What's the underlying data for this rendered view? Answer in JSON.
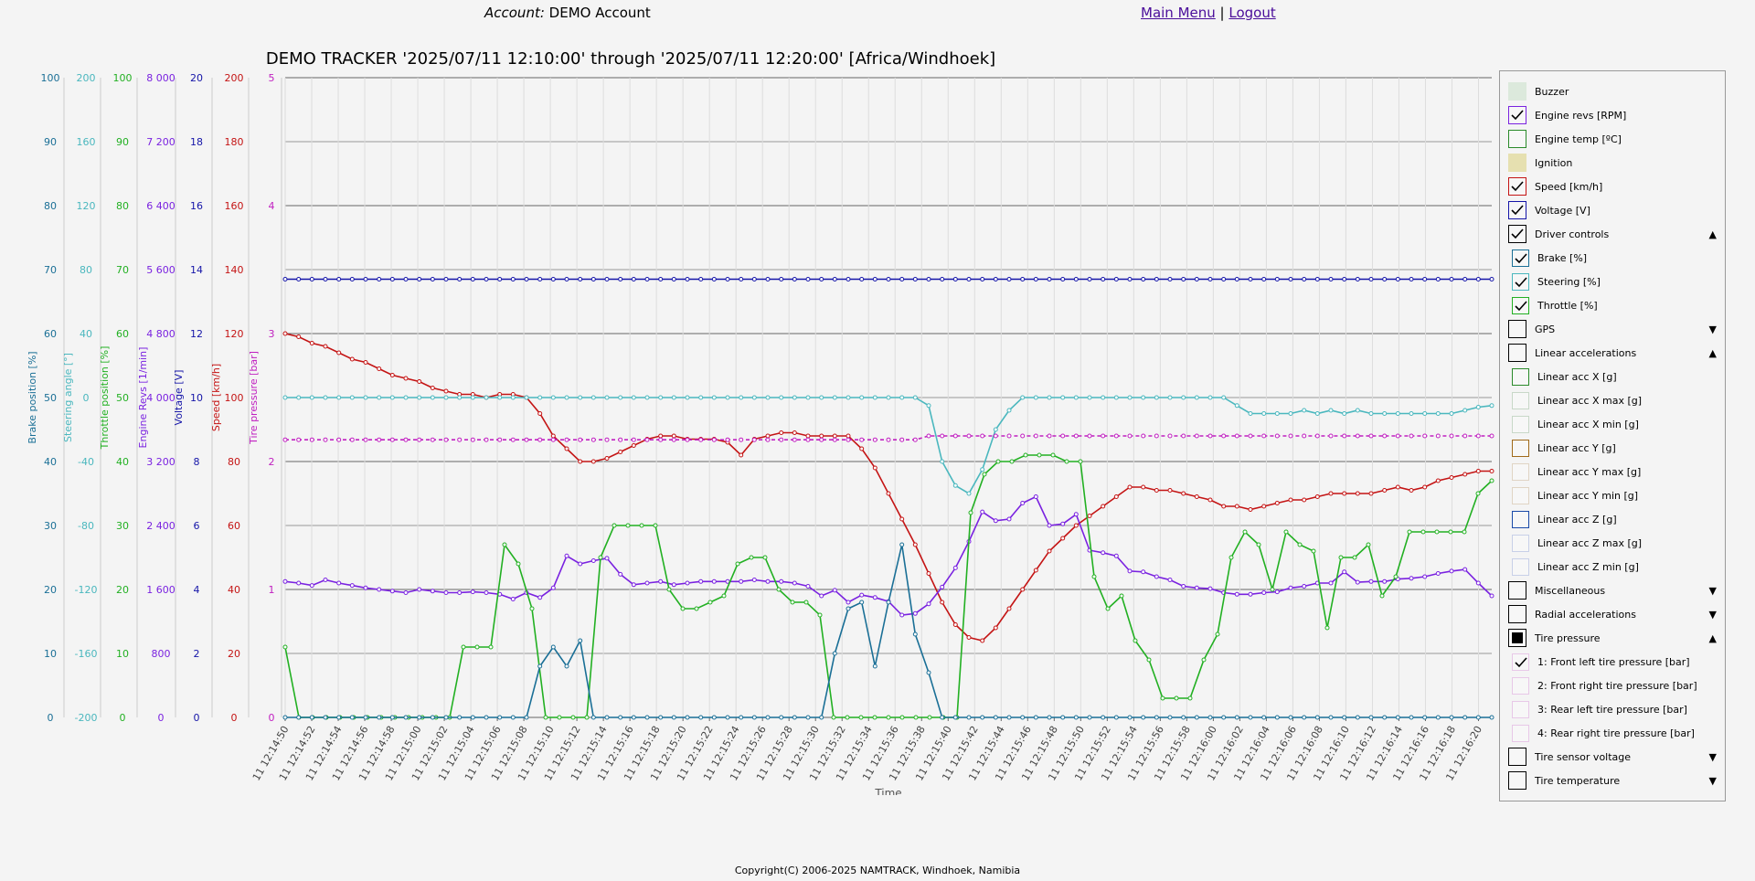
{
  "header": {
    "account_label": "Account:",
    "account_name": "DEMO Account",
    "main_menu": "Main Menu",
    "separator": "|",
    "logout": "Logout"
  },
  "footer": {
    "copyright": "Copyright(C) 2006-2025 NAMTRACK, Windhoek, Namibia"
  },
  "chart_data": {
    "type": "line",
    "title": "DEMO TRACKER '2025/07/11 12:10:00' through '2025/07/11 12:20:00' [Africa/Windhoek]",
    "xlabel": "Time",
    "x_range": [
      "11 12:14:50",
      "11 12:16:21"
    ],
    "x_ticks": [
      "11 12:14:50",
      "11 12:14:52",
      "11 12:14:54",
      "11 12:14:56",
      "11 12:14:58",
      "11 12:15:00",
      "11 12:15:02",
      "11 12:15:04",
      "11 12:15:06",
      "11 12:15:08",
      "11 12:15:10",
      "11 12:15:12",
      "11 12:15:14",
      "11 12:15:16",
      "11 12:15:18",
      "11 12:15:20",
      "11 12:15:22",
      "11 12:15:24",
      "11 12:15:26",
      "11 12:15:28",
      "11 12:15:30",
      "11 12:15:32",
      "11 12:15:34",
      "11 12:15:36",
      "11 12:15:38",
      "11 12:15:40",
      "11 12:15:42",
      "11 12:15:44",
      "11 12:15:46",
      "11 12:15:48",
      "11 12:15:50",
      "11 12:15:52",
      "11 12:15:54",
      "11 12:15:56",
      "11 12:15:58",
      "11 12:16:00",
      "11 12:16:02",
      "11 12:16:04",
      "11 12:16:06",
      "11 12:16:08",
      "11 12:16:10",
      "11 12:16:12",
      "11 12:16:14",
      "11 12:16:16",
      "11 12:16:18",
      "11 12:16:20"
    ],
    "grid": true,
    "axes": [
      {
        "label": "Brake position [%]",
        "color": "#1a6f96",
        "ticks": [
          "0",
          "10",
          "20",
          "30",
          "40",
          "50",
          "60",
          "70",
          "80",
          "90",
          "100"
        ],
        "range": [
          0,
          100
        ]
      },
      {
        "label": "Steering angle [°]",
        "color": "#4ab7be",
        "ticks": [
          "-200",
          "-160",
          "-120",
          "-80",
          "-40",
          "0",
          "40",
          "80",
          "120",
          "160",
          "200"
        ],
        "range": [
          -200,
          200
        ]
      },
      {
        "label": "Throttle position [%]",
        "color": "#22b022",
        "ticks": [
          "0",
          "10",
          "20",
          "30",
          "40",
          "50",
          "60",
          "70",
          "80",
          "90",
          "100"
        ],
        "range": [
          0,
          100
        ]
      },
      {
        "label": "Engine Revs [1/min]",
        "color": "#7a22e0",
        "ticks": [
          "0",
          "800",
          "1 600",
          "2 400",
          "3 200",
          "4 000",
          "4 800",
          "5 600",
          "6 400",
          "7 200",
          "8 000"
        ],
        "range": [
          0,
          8000
        ]
      },
      {
        "label": "Voltage [V]",
        "color": "#1515a8",
        "ticks": [
          "0",
          "2",
          "4",
          "6",
          "8",
          "10",
          "12",
          "14",
          "16",
          "18",
          "20"
        ],
        "range": [
          0,
          20
        ]
      },
      {
        "label": "Speed [km/h]",
        "color": "#c41414",
        "ticks": [
          "0",
          "20",
          "40",
          "60",
          "80",
          "100",
          "120",
          "140",
          "160",
          "180",
          "200"
        ],
        "range": [
          0,
          200
        ]
      },
      {
        "label": "Tire pressure [bar]",
        "color": "#c020c0",
        "ticks": [
          "0",
          "1",
          "2",
          "3",
          "4",
          "5"
        ],
        "range": [
          0,
          5
        ]
      }
    ],
    "series": [
      {
        "name": "Speed [km/h]",
        "axis": 5,
        "color": "#c41414",
        "values": [
          120,
          119,
          117,
          116,
          114,
          112,
          111,
          109,
          107,
          106,
          105,
          103,
          102,
          101,
          101,
          100,
          101,
          101,
          100,
          95,
          88,
          84,
          80,
          80,
          81,
          83,
          85,
          87,
          88,
          88,
          87,
          87,
          87,
          86,
          82,
          87,
          88,
          89,
          89,
          88,
          88,
          88,
          88,
          84,
          78,
          70,
          62,
          54,
          45,
          36,
          29,
          25,
          24,
          28,
          34,
          40,
          46,
          52,
          56,
          60,
          63,
          66,
          69,
          72,
          72,
          71,
          71,
          70,
          69,
          68,
          66,
          66,
          65,
          66,
          67,
          68,
          68,
          69,
          70,
          70,
          70,
          70,
          71,
          72,
          71,
          72,
          74,
          75,
          76,
          77,
          77
        ]
      },
      {
        "name": "Voltage [V]",
        "axis": 4,
        "color": "#1515a8",
        "values": [
          13.7,
          13.7,
          13.7,
          13.7,
          13.7,
          13.7,
          13.7,
          13.7,
          13.7,
          13.7,
          13.7,
          13.7,
          13.7,
          13.7,
          13.7,
          13.7,
          13.7,
          13.7,
          13.7,
          13.7,
          13.7,
          13.7,
          13.7,
          13.7,
          13.7,
          13.7,
          13.7,
          13.7,
          13.7,
          13.7,
          13.7,
          13.7,
          13.7,
          13.7,
          13.7,
          13.7,
          13.7,
          13.7,
          13.7,
          13.7,
          13.7,
          13.7,
          13.7,
          13.7,
          13.7,
          13.7,
          13.7,
          13.7,
          13.7,
          13.7,
          13.7,
          13.7,
          13.7,
          13.7,
          13.7,
          13.7,
          13.7,
          13.7,
          13.7,
          13.7,
          13.7,
          13.7,
          13.7,
          13.7,
          13.7,
          13.7,
          13.7,
          13.7,
          13.7,
          13.7,
          13.7,
          13.7,
          13.7,
          13.7,
          13.7,
          13.7,
          13.7,
          13.7,
          13.7,
          13.7,
          13.7,
          13.7,
          13.7,
          13.7,
          13.7,
          13.7,
          13.7,
          13.7,
          13.7,
          13.7,
          13.7
        ]
      },
      {
        "name": "Engine revs [RPM]",
        "axis": 3,
        "color": "#7a22e0",
        "values": [
          1700,
          1680,
          1650,
          1720,
          1680,
          1650,
          1620,
          1600,
          1580,
          1560,
          1600,
          1580,
          1560,
          1560,
          1570,
          1560,
          1540,
          1480,
          1560,
          1500,
          1620,
          2020,
          1920,
          1960,
          1990,
          1790,
          1660,
          1680,
          1700,
          1660,
          1680,
          1700,
          1700,
          1700,
          1700,
          1720,
          1700,
          1700,
          1680,
          1640,
          1520,
          1590,
          1440,
          1530,
          1500,
          1450,
          1280,
          1300,
          1420,
          1630,
          1870,
          2200,
          2570,
          2460,
          2480,
          2680,
          2760,
          2400,
          2420,
          2540,
          2090,
          2060,
          2020,
          1830,
          1820,
          1760,
          1720,
          1640,
          1620,
          1610,
          1560,
          1540,
          1540,
          1560,
          1570,
          1620,
          1640,
          1680,
          1680,
          1820,
          1690,
          1700,
          1700,
          1730,
          1740,
          1760,
          1800,
          1830,
          1850,
          1680,
          1520
        ]
      },
      {
        "name": "Steering [%]",
        "axis": 1,
        "color": "#4ab7be",
        "values": [
          0,
          0,
          0,
          0,
          0,
          0,
          0,
          0,
          0,
          0,
          0,
          0,
          0,
          0,
          0,
          0,
          0,
          0,
          0,
          0,
          0,
          0,
          0,
          0,
          0,
          0,
          0,
          0,
          0,
          0,
          0,
          0,
          0,
          0,
          0,
          0,
          0,
          0,
          0,
          0,
          0,
          0,
          0,
          0,
          0,
          0,
          0,
          0,
          -5,
          -40,
          -55,
          -60,
          -45,
          -20,
          -8,
          0,
          0,
          0,
          0,
          0,
          0,
          0,
          0,
          0,
          0,
          0,
          0,
          0,
          0,
          0,
          0,
          -5,
          -10,
          -10,
          -10,
          -10,
          -8,
          -10,
          -8,
          -10,
          -8,
          -10,
          -10,
          -10,
          -10,
          -10,
          -10,
          -10,
          -8,
          -6,
          -5
        ]
      },
      {
        "name": "Throttle [%]",
        "axis": 2,
        "color": "#22b022",
        "values": [
          11,
          0,
          0,
          0,
          0,
          0,
          0,
          0,
          0,
          0,
          0,
          0,
          0,
          11,
          11,
          11,
          27,
          24,
          17,
          0,
          0,
          0,
          0,
          25,
          30,
          30,
          30,
          30,
          20,
          17,
          17,
          18,
          19,
          24,
          25,
          25,
          20,
          18,
          18,
          16,
          0,
          0,
          0,
          0,
          0,
          0,
          0,
          0,
          0,
          0,
          32,
          38,
          40,
          40,
          41,
          41,
          41,
          40,
          40,
          22,
          17,
          19,
          12,
          9,
          3,
          3,
          3,
          9,
          13,
          25,
          29,
          27,
          20,
          29,
          27,
          26,
          14,
          25,
          25,
          27,
          19,
          22,
          29,
          29,
          29,
          29,
          29,
          35,
          37
        ]
      },
      {
        "name": "Brake [%]",
        "axis": 0,
        "color": "#1a6f96",
        "values": [
          0,
          0,
          0,
          0,
          0,
          0,
          0,
          0,
          0,
          0,
          0,
          0,
          0,
          0,
          0,
          0,
          0,
          0,
          0,
          8,
          11,
          8,
          12,
          0,
          0,
          0,
          0,
          0,
          0,
          0,
          0,
          0,
          0,
          0,
          0,
          0,
          0,
          0,
          0,
          0,
          0,
          10,
          17,
          18,
          8,
          18,
          27,
          13,
          7,
          0,
          0,
          0,
          0,
          0,
          0,
          0,
          0,
          0,
          0,
          0,
          0,
          0,
          0,
          0,
          0,
          0,
          0,
          0,
          0,
          0,
          0,
          0,
          0,
          0,
          0,
          0,
          0,
          0,
          0,
          0,
          0,
          0,
          0,
          0,
          0,
          0,
          0,
          0,
          0,
          0,
          0
        ]
      },
      {
        "name": "1: Front left tire pressure [bar]",
        "axis": 6,
        "color": "#c020c0",
        "dashed": true,
        "values": [
          2.17,
          2.17,
          2.17,
          2.17,
          2.17,
          2.17,
          2.17,
          2.17,
          2.17,
          2.17,
          2.17,
          2.17,
          2.17,
          2.17,
          2.17,
          2.17,
          2.17,
          2.17,
          2.17,
          2.17,
          2.17,
          2.17,
          2.17,
          2.17,
          2.17,
          2.17,
          2.17,
          2.17,
          2.17,
          2.17,
          2.17,
          2.17,
          2.17,
          2.17,
          2.17,
          2.17,
          2.17,
          2.17,
          2.17,
          2.17,
          2.17,
          2.17,
          2.17,
          2.17,
          2.17,
          2.17,
          2.17,
          2.17,
          2.2,
          2.2,
          2.2,
          2.2,
          2.2,
          2.2,
          2.2,
          2.2,
          2.2,
          2.2,
          2.2,
          2.2,
          2.2,
          2.2,
          2.2,
          2.2,
          2.2,
          2.2,
          2.2,
          2.2,
          2.2,
          2.2,
          2.2,
          2.2,
          2.2,
          2.2,
          2.2,
          2.2,
          2.2,
          2.2,
          2.2,
          2.2,
          2.2,
          2.2,
          2.2,
          2.2,
          2.2,
          2.2,
          2.2,
          2.2,
          2.2,
          2.2,
          2.2
        ]
      }
    ]
  },
  "legend_panel": {
    "items": [
      {
        "label": "Buzzer",
        "state": "filled",
        "color": "#dce9dc",
        "indent": false
      },
      {
        "label": "Engine revs [RPM]",
        "state": "checked",
        "color": "#7a22e0",
        "indent": false
      },
      {
        "label": "Engine temp [ºC]",
        "state": "empty",
        "color": "#2a8a2a",
        "indent": false
      },
      {
        "label": "Ignition",
        "state": "filled",
        "color": "#e6e0b0",
        "indent": false
      },
      {
        "label": "Speed [km/h]",
        "state": "checked",
        "color": "#c41414",
        "indent": false
      },
      {
        "label": "Voltage [V]",
        "state": "checked",
        "color": "#1515a8",
        "indent": false
      },
      {
        "label": "Driver controls",
        "state": "checked",
        "color": "#000000",
        "indent": false,
        "arrow": "▲"
      },
      {
        "label": "Brake [%]",
        "state": "checked",
        "color": "#1a6f96",
        "indent": true
      },
      {
        "label": "Steering [%]",
        "state": "checked",
        "color": "#4ab7be",
        "indent": true
      },
      {
        "label": "Throttle [%]",
        "state": "checked",
        "color": "#22b022",
        "indent": true
      },
      {
        "label": "GPS",
        "state": "empty",
        "color": "#000000",
        "indent": false,
        "arrow": "▼"
      },
      {
        "label": "Linear accelerations",
        "state": "empty",
        "color": "#000000",
        "indent": false,
        "arrow": "▲"
      },
      {
        "label": "Linear acc X [g]",
        "state": "empty",
        "color": "#2a8a2a",
        "indent": true
      },
      {
        "label": "Linear acc X max [g]",
        "state": "empty",
        "color": "#c8d8c8",
        "indent": true
      },
      {
        "label": "Linear acc X min [g]",
        "state": "empty",
        "color": "#c8d8c8",
        "indent": true
      },
      {
        "label": "Linear acc Y [g]",
        "state": "empty",
        "color": "#a06a1a",
        "indent": true
      },
      {
        "label": "Linear acc Y max [g]",
        "state": "empty",
        "color": "#e0d4c4",
        "indent": true
      },
      {
        "label": "Linear acc Y min [g]",
        "state": "empty",
        "color": "#e0d4c4",
        "indent": true
      },
      {
        "label": "Linear acc Z [g]",
        "state": "empty",
        "color": "#1a4aa8",
        "indent": true
      },
      {
        "label": "Linear acc Z max [g]",
        "state": "empty",
        "color": "#c8d0e8",
        "indent": true
      },
      {
        "label": "Linear acc Z min [g]",
        "state": "empty",
        "color": "#c8d0e8",
        "indent": true
      },
      {
        "label": "Miscellaneous",
        "state": "empty",
        "color": "#000000",
        "indent": false,
        "arrow": "▼"
      },
      {
        "label": "Radial accelerations",
        "state": "empty",
        "color": "#000000",
        "indent": false,
        "arrow": "▼"
      },
      {
        "label": "Tire pressure",
        "state": "solid",
        "color": "#000000",
        "indent": false,
        "arrow": "▲"
      },
      {
        "label": "1: Front left tire pressure [bar]",
        "state": "checked",
        "color": "#e8c8e8",
        "indent": true
      },
      {
        "label": "2: Front right tire pressure [bar]",
        "state": "empty",
        "color": "#e8c8e8",
        "indent": true
      },
      {
        "label": "3: Rear left tire pressure [bar]",
        "state": "empty",
        "color": "#e8c8e8",
        "indent": true
      },
      {
        "label": "4: Rear right tire pressure [bar]",
        "state": "empty",
        "color": "#e8c8e8",
        "indent": true
      },
      {
        "label": "Tire sensor voltage",
        "state": "empty",
        "color": "#000000",
        "indent": false,
        "arrow": "▼"
      },
      {
        "label": "Tire temperature",
        "state": "empty",
        "color": "#000000",
        "indent": false,
        "arrow": "▼"
      }
    ]
  }
}
